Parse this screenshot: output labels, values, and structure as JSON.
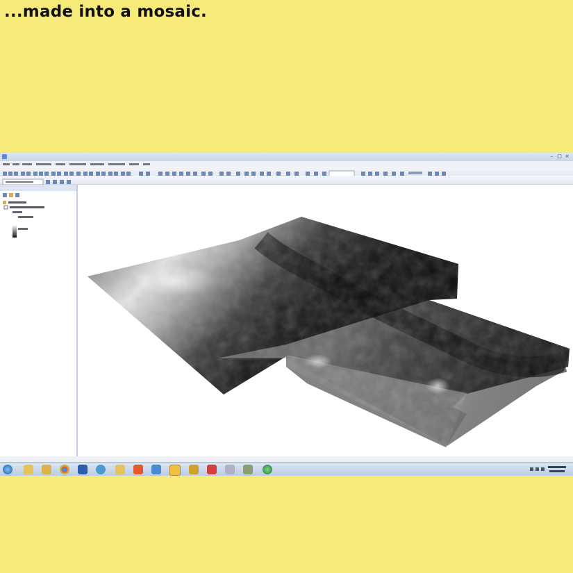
{
  "slide": {
    "title": "...made into a mosaic."
  },
  "colors": {
    "background": "#f5ea7a",
    "window_chrome": "#dfe7f2",
    "taskbar": "#c9d8ea",
    "raster_dark": "#0a0a0a",
    "raster_light": "#f5f5f5"
  },
  "app": {
    "title_icon": "arcmap-icon",
    "window_controls": [
      "minimize-icon",
      "maximize-icon",
      "close-icon"
    ],
    "toc": {
      "icons": [
        "list-icon",
        "folder-icon",
        "layers-icon"
      ]
    },
    "map": {
      "content": "mosaic-raster",
      "colormap": "grayscale-stretch"
    }
  },
  "taskbar": {
    "icons": [
      "start-orb-icon",
      "folder-icon",
      "explorer-icon",
      "chrome-icon",
      "word-icon",
      "network-icon",
      "folder-icon",
      "app-icon",
      "document-icon",
      "arcmap-icon",
      "app-icon",
      "pdf-icon",
      "tool-icon",
      "tool-icon",
      "globe-icon"
    ]
  }
}
